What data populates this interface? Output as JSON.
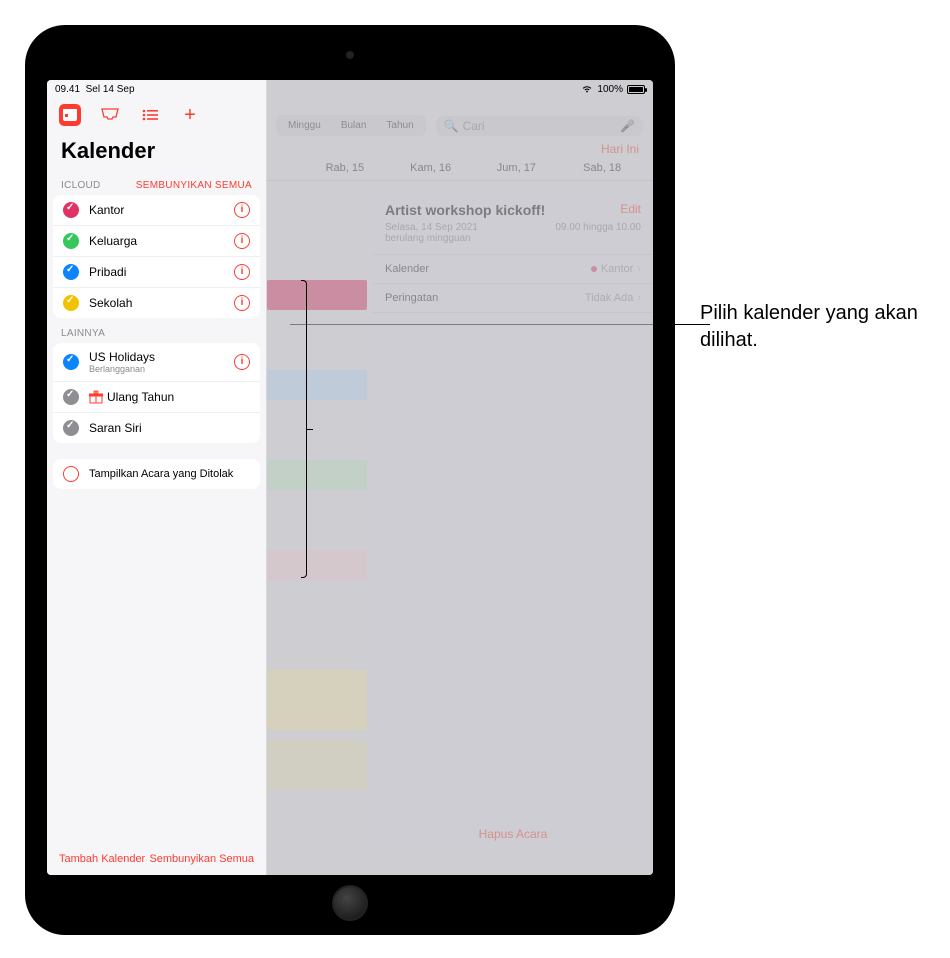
{
  "status": {
    "time": "09.41",
    "date": "Sel 14 Sep",
    "battery": "100%"
  },
  "sidebar": {
    "title": "Kalender",
    "icloud": {
      "header": "ICLOUD",
      "hide": "SEMBUNYIKAN SEMUA",
      "items": [
        {
          "label": "Kantor",
          "color": "#e23265"
        },
        {
          "label": "Keluarga",
          "color": "#34c759"
        },
        {
          "label": "Pribadi",
          "color": "#0a84ff"
        },
        {
          "label": "Sekolah",
          "color": "#f2c200"
        }
      ]
    },
    "other": {
      "header": "LAINNYA",
      "items": [
        {
          "label": "US Holidays",
          "sub": "Berlangganan",
          "color": "#0a84ff",
          "checked": true,
          "info": true
        },
        {
          "label": "Ulang Tahun",
          "color": "#8e8e93",
          "checked": true,
          "gift": true
        },
        {
          "label": "Saran Siri",
          "color": "#8e8e93",
          "checked": true
        }
      ]
    },
    "declined": "Tampilkan Acara yang Ditolak",
    "add": "Tambah Kalender",
    "hideAll": "Sembunyikan Semua"
  },
  "main": {
    "segments": [
      "Minggu",
      "Bulan",
      "Tahun"
    ],
    "searchPlaceholder": "Cari",
    "today": "Hari Ini",
    "days": [
      "Rab, 15",
      "Kam, 16",
      "Jum, 17",
      "Sab, 18"
    ]
  },
  "event": {
    "title": "Artist workshop kickoff!",
    "edit": "Edit",
    "date": "Selasa, 14 Sep 2021",
    "time": "09.00 hingga 10.00",
    "repeat": "berulang mingguan",
    "calLabel": "Kalender",
    "calValue": "Kantor",
    "alertLabel": "Peringatan",
    "alertValue": "Tidak Ada",
    "delete": "Hapus Acara"
  },
  "callout": "Pilih kalender yang akan dilihat."
}
